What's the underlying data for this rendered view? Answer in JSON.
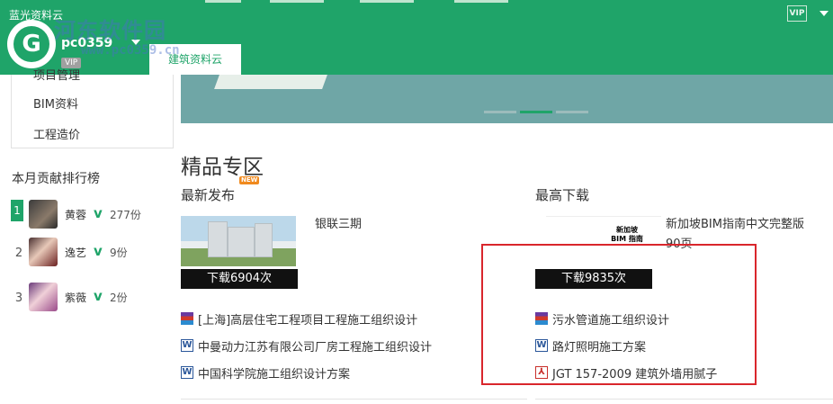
{
  "header": {
    "app_title": "蓝光资料云",
    "logo_letter": "G",
    "username": "pc0359",
    "vip_badge": "VIP",
    "active_tab": "建筑资料云",
    "vip_icon": "VIP",
    "watermark": "河东软件园",
    "watermark_url": "www.pc0359.cn",
    "color_primary": "#1fa469"
  },
  "sidebar": {
    "items": [
      {
        "label": "项目管理"
      },
      {
        "label": "BIM资料"
      },
      {
        "label": "工程造价"
      }
    ],
    "ranking_title": "本月贡献排行榜",
    "ranking": [
      {
        "rank": "1",
        "name": "黄蓉",
        "score": "277份"
      },
      {
        "rank": "2",
        "name": "逸艺",
        "score": "9份"
      },
      {
        "rank": "3",
        "name": "紫薇",
        "score": "2份"
      }
    ]
  },
  "main": {
    "section_title": "精品专区",
    "latest": {
      "title": "最新发布",
      "badge": "NEW",
      "featured_title": "银联三期",
      "download_label": "下载6904次",
      "files": [
        {
          "icon": "rar-icon",
          "name": "[上海]高层住宅工程项目工程施工组织设计"
        },
        {
          "icon": "word-icon",
          "name": "中曼动力江苏有限公司厂房工程施工组织设计"
        },
        {
          "icon": "word-icon",
          "name": "中国科学院施工组织设计方案"
        }
      ]
    },
    "top_downloads": {
      "title": "最高下载",
      "thumb_text": "新加坡 BIM 指南",
      "featured_title": "新加坡BIM指南中文完整版90页",
      "download_label": "下载9835次",
      "files": [
        {
          "icon": "rar-icon",
          "name": "污水管道施工组织设计"
        },
        {
          "icon": "word-icon",
          "name": "路灯照明施工方案"
        },
        {
          "icon": "pdf-icon",
          "name": "JGT 157-2009 建筑外墙用腻子"
        }
      ]
    }
  },
  "icons": {
    "word_glyph": "W",
    "pdf_glyph": "⅄"
  }
}
